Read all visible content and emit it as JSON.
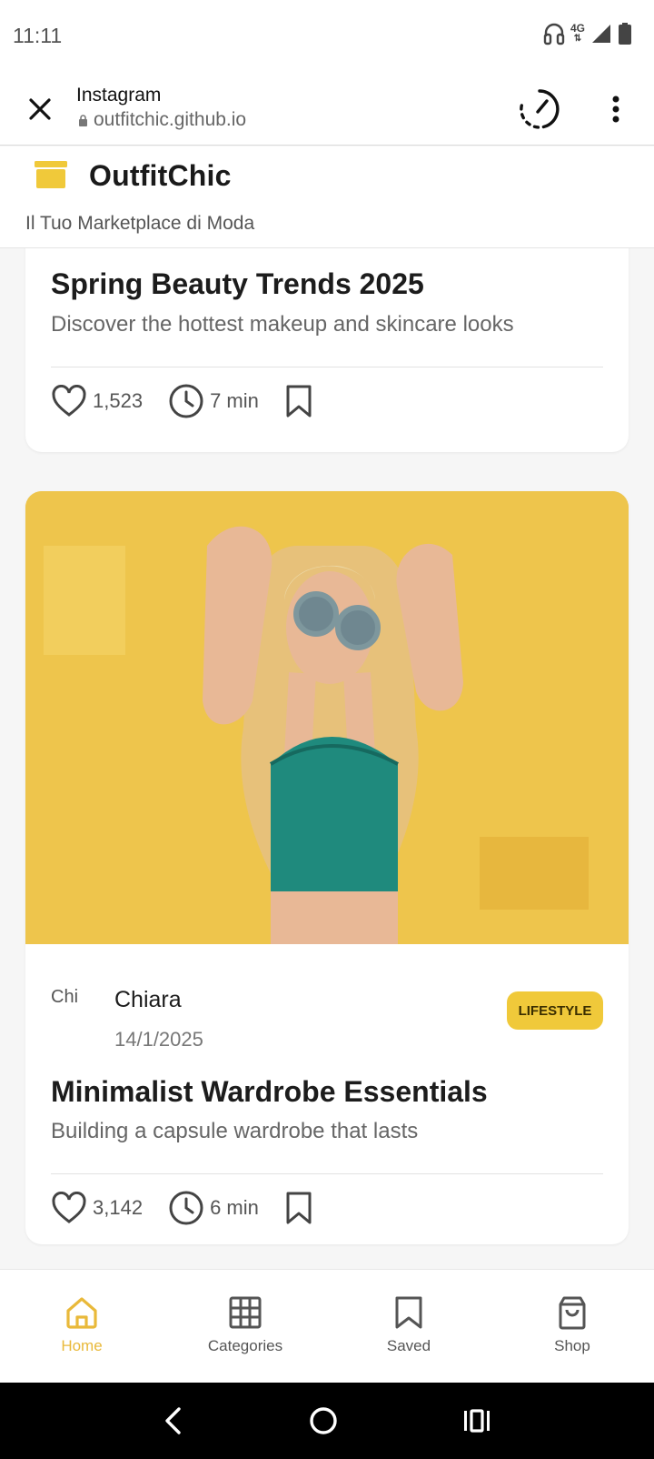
{
  "status_bar": {
    "time": "11:11",
    "network": "4G"
  },
  "browser": {
    "title": "Instagram",
    "url": "outfitchic.github.io"
  },
  "app": {
    "name": "OutfitChic",
    "tagline": "Il Tuo Marketplace di Moda",
    "brand_color": "#f0c93a"
  },
  "posts": [
    {
      "title": "Spring Beauty Trends 2025",
      "subtitle": "Discover the hottest makeup and skincare looks",
      "likes": "1,523",
      "read_time": "7 min"
    },
    {
      "author": "Chiara",
      "avatar_alt": "Chi",
      "date": "14/1/2025",
      "category": "LIFESTYLE",
      "title": "Minimalist Wardrobe Essentials",
      "subtitle": "Building a capsule wardrobe that lasts",
      "likes": "3,142",
      "read_time": "6 min"
    }
  ],
  "bottom_nav": [
    {
      "label": "Home",
      "icon": "home-icon",
      "active": true
    },
    {
      "label": "Categories",
      "icon": "grid-icon",
      "active": false
    },
    {
      "label": "Saved",
      "icon": "bookmark-icon",
      "active": false
    },
    {
      "label": "Shop",
      "icon": "shopping-bag-icon",
      "active": false
    }
  ]
}
